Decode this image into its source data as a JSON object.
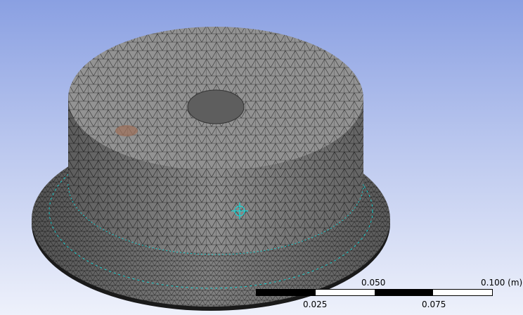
{
  "viewport": {
    "model": "mesh-part",
    "colors": {
      "mesh_fill": "#8c8c8c",
      "mesh_lines": "#2b2b2b",
      "edge_highlight": "#00e5e5",
      "background_top": "#8aa0e2",
      "background_bottom": "#eef1fb"
    }
  },
  "scale_bar": {
    "unit_label": "0.100 (m)",
    "top_labels": [
      "0.050"
    ],
    "bottom_labels": [
      "0.025",
      "0.075"
    ]
  }
}
